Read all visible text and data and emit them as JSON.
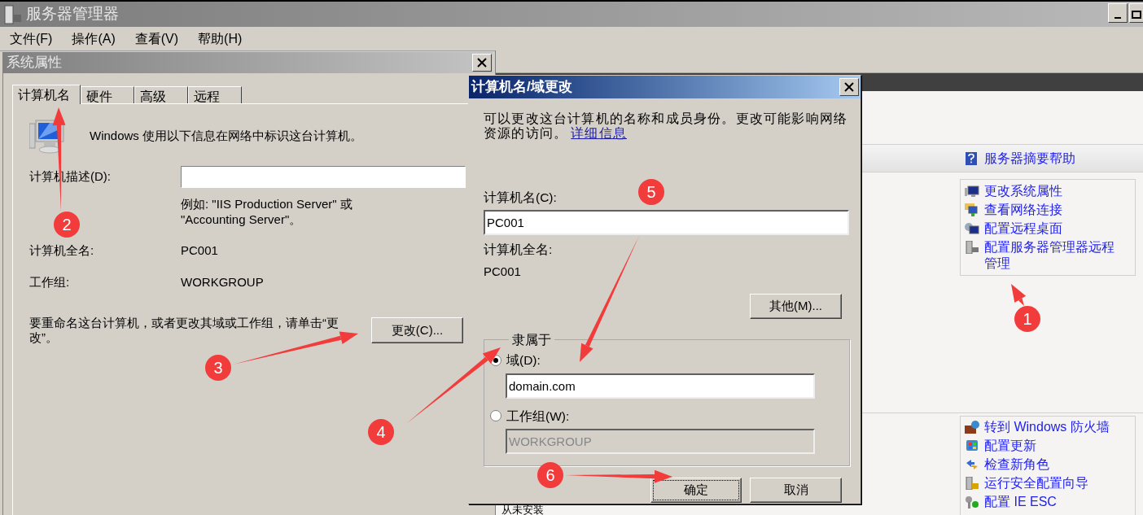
{
  "main_window": {
    "title": "服务器管理器",
    "menu": [
      "文件(F)",
      "操作(A)",
      "查看(V)",
      "帮助(H)"
    ]
  },
  "summary_panel": {
    "help_link": "服务器摘要帮助",
    "tasks": [
      "更改系统属性",
      "查看网络连接",
      "配置远程桌面",
      "配置服务器管理器远程管理"
    ],
    "security_tasks": [
      "转到 Windows 防火墙",
      "配置更新",
      "检查新角色",
      "运行安全配置向导",
      "配置 IE ESC"
    ],
    "footer_text": "从未安装"
  },
  "system_properties": {
    "title": "系统属性",
    "tabs": [
      {
        "label": "计算机名",
        "selected": true
      },
      {
        "label": "硬件",
        "selected": false
      },
      {
        "label": "高级",
        "selected": false
      },
      {
        "label": "远程",
        "selected": false
      }
    ],
    "intro": "Windows 使用以下信息在网络中标识这台计算机。",
    "description_label": "计算机描述(D):",
    "example": "例如: \"IIS Production Server\" 或 \"Accounting Server\"。",
    "full_name_label": "计算机全名:",
    "full_name": "PC001",
    "workgroup_label": "工作组:",
    "workgroup": "WORKGROUP",
    "rename_text": "要重命名这台计算机，或者更改其域或工作组，请单击“更改”。",
    "change_button": "更改(C)..."
  },
  "rename_dialog": {
    "title": "计算机名/域更改",
    "description": "可以更改这台计算机的名称和成员身份。更改可能影响网络资源的访问。",
    "details_link": "详细信息",
    "computer_name_label": "计算机名(C):",
    "computer_name": "PC001",
    "full_name_label": "计算机全名:",
    "full_name": "PC001",
    "more_button": "其他(M)...",
    "member_of": "隶属于",
    "options": [
      {
        "label": "域(D):",
        "selected": true,
        "value": "domain.com",
        "disabled": false
      },
      {
        "label": "工作组(W):",
        "selected": false,
        "value": "WORKGROUP",
        "disabled": true
      }
    ],
    "ok_button": "确定",
    "cancel_button": "取消"
  },
  "annotations": [
    "1",
    "2",
    "3",
    "4",
    "5",
    "6"
  ]
}
